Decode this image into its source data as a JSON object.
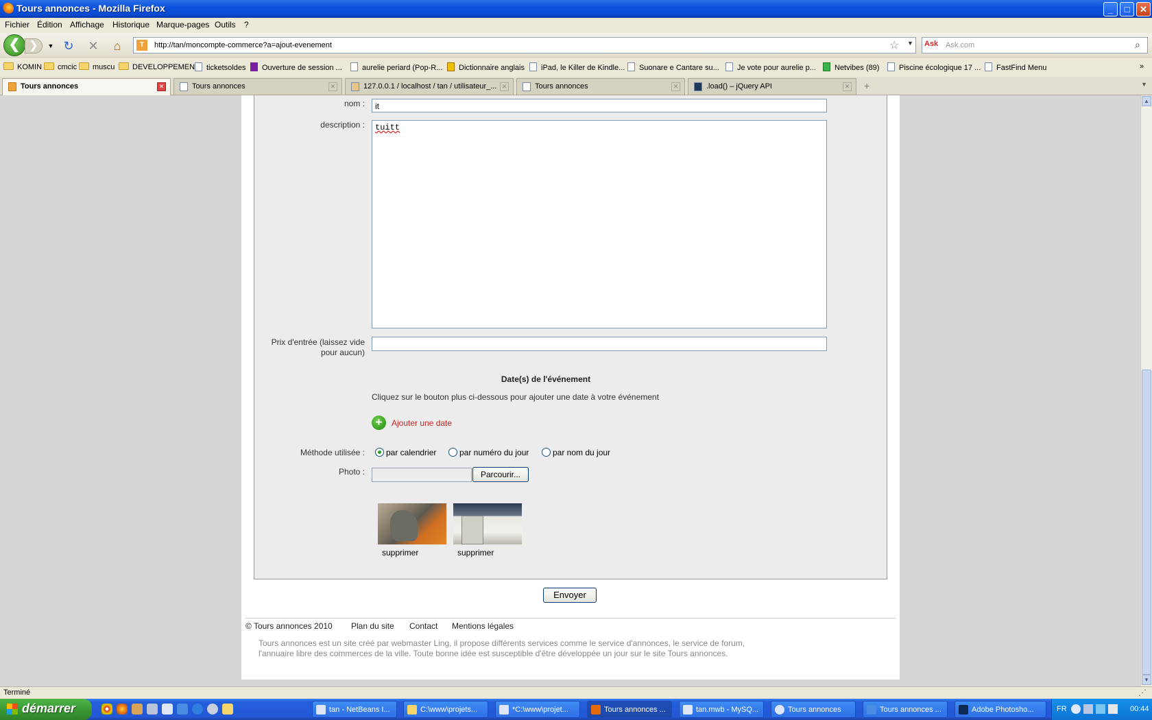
{
  "window": {
    "title": "Tours annonces - Mozilla Firefox",
    "minimize": "_",
    "maximize": "□",
    "close": "✕"
  },
  "menu": [
    "Fichier",
    "Édition",
    "Affichage",
    "Historique",
    "Marque-pages",
    "Outils",
    "?"
  ],
  "nav": {
    "url": "http://tan/moncompte-commerce?a=ajout-evenement",
    "search_placeholder": "Ask.com",
    "search_engine": "Ask"
  },
  "bookmarks": [
    "KOMIN",
    "cmcic",
    "muscu",
    "DEVELOPPEMENT",
    "ticketsoldes",
    "Ouverture de session ...",
    "aurelie periard (Pop-R...",
    "Dictionnaire anglais",
    "iPad, le Killer de Kindle...",
    "Suonare e Cantare su...",
    "Je vote pour aurelie p...",
    "Netvibes (89)",
    "Piscine écologique 17 ...",
    "FastFind Menu"
  ],
  "tabs": [
    "Tours annonces",
    "Tours annonces",
    "127.0.0.1 / localhost / tan / utilisateur_...",
    "Tours annonces",
    ".load() – jQuery API"
  ],
  "form": {
    "nom_label": "nom :",
    "nom_value": "it",
    "description_label": "description :",
    "description_value": "tuitt",
    "prix_label_1": "Prix d'entrée (laissez vide",
    "prix_label_2": "pour aucun)",
    "prix_value": "",
    "dates_heading": "Date(s) de l'événement",
    "dates_help": "Cliquez sur le bouton plus ci-dessous pour ajouter une date à votre événement",
    "add_date": "Ajouter une date",
    "methode_label": "Méthode utilisée :",
    "methods": [
      "par calendrier",
      "par numéro du jour",
      "par nom du jour"
    ],
    "methode_selected": "par calendrier",
    "photo_label": "Photo :",
    "browse": "Parcourir...",
    "photos": [
      {
        "action": "supprimer"
      },
      {
        "action": "supprimer"
      }
    ],
    "submit": "Envoyer"
  },
  "footer": {
    "copyright": "© Tours annonces 2010",
    "links": [
      "Plan du site",
      "Contact",
      "Mentions légales"
    ],
    "line1": "Tours annonces est un site créé par webmaster Ling, il propose différents services comme le service d'annonces, le service de forum,",
    "line2": "l'annuaire libre des commerces de la ville. Toute bonne idée est susceptible d'être développée un jour sur le site Tours annonces."
  },
  "status": "Terminé",
  "taskbar": {
    "start": "démarrer",
    "items": [
      "tan - NetBeans I...",
      "C:\\www\\projets...",
      "*C:\\www\\projet...",
      "Tours annonces ...",
      "tan.mwb - MySQ...",
      "Tours annonces",
      "Tours annonces ...",
      "Adobe Photosho..."
    ],
    "lang": "FR",
    "clock": "00:44"
  }
}
